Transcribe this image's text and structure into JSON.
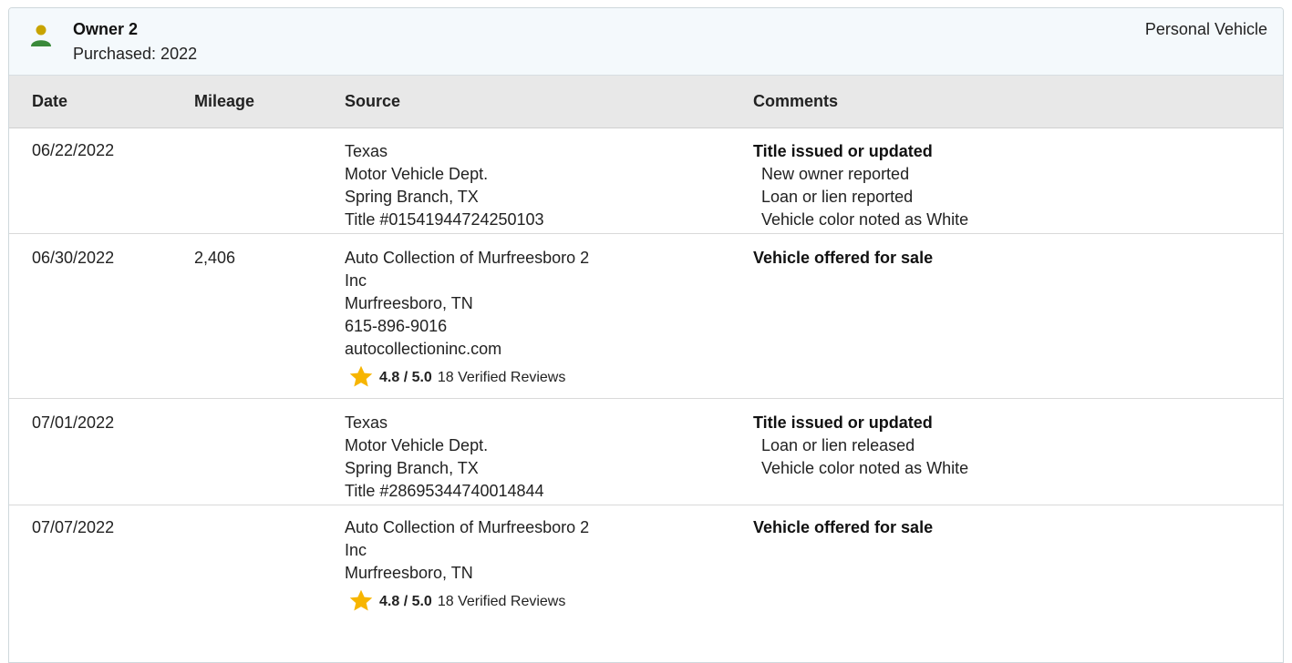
{
  "owner": {
    "title": "Owner 2",
    "purchased": "Purchased: 2022",
    "type": "Personal Vehicle",
    "icon": "person-icon",
    "icon_color": "#c8a400",
    "icon_body_color": "#3a8a3a"
  },
  "table": {
    "headers": [
      "Date",
      "Mileage",
      "Source",
      "Comments"
    ],
    "rows": [
      {
        "date": "06/22/2022",
        "mileage": "",
        "source": [
          "Texas",
          "Motor Vehicle Dept.",
          "Spring Branch, TX",
          "Title #01541944724250103"
        ],
        "comment_title": "Title issued or updated",
        "comment_items": [
          "New owner reported",
          "Loan or lien reported",
          "Vehicle color noted as White"
        ],
        "rating": null
      },
      {
        "date": "06/30/2022",
        "mileage": "2,406",
        "source": [
          "Auto Collection of Murfreesboro 2",
          "Inc",
          "Murfreesboro, TN",
          "615-896-9016",
          "autocollectioninc.com"
        ],
        "comment_title": "Vehicle offered for sale",
        "comment_items": [],
        "rating": {
          "score": "4.8 / 5.0",
          "reviews": "18 Verified Reviews"
        }
      },
      {
        "date": "07/01/2022",
        "mileage": "",
        "source": [
          "Texas",
          "Motor Vehicle Dept.",
          "Spring Branch, TX",
          "Title #28695344740014844"
        ],
        "comment_title": "Title issued or updated",
        "comment_items": [
          "Loan or lien released",
          "Vehicle color noted as White"
        ],
        "rating": null
      },
      {
        "date": "07/07/2022",
        "mileage": "",
        "source": [
          "Auto Collection of Murfreesboro 2",
          "Inc",
          "Murfreesboro, TN"
        ],
        "comment_title": "Vehicle offered for sale",
        "comment_items": [],
        "rating": {
          "score": "4.8 / 5.0",
          "reviews": "18 Verified Reviews"
        }
      }
    ]
  },
  "colors": {
    "star": "#f7b500",
    "header_bg": "#e8e8e8",
    "owner_bg": "#f4f9fc"
  }
}
